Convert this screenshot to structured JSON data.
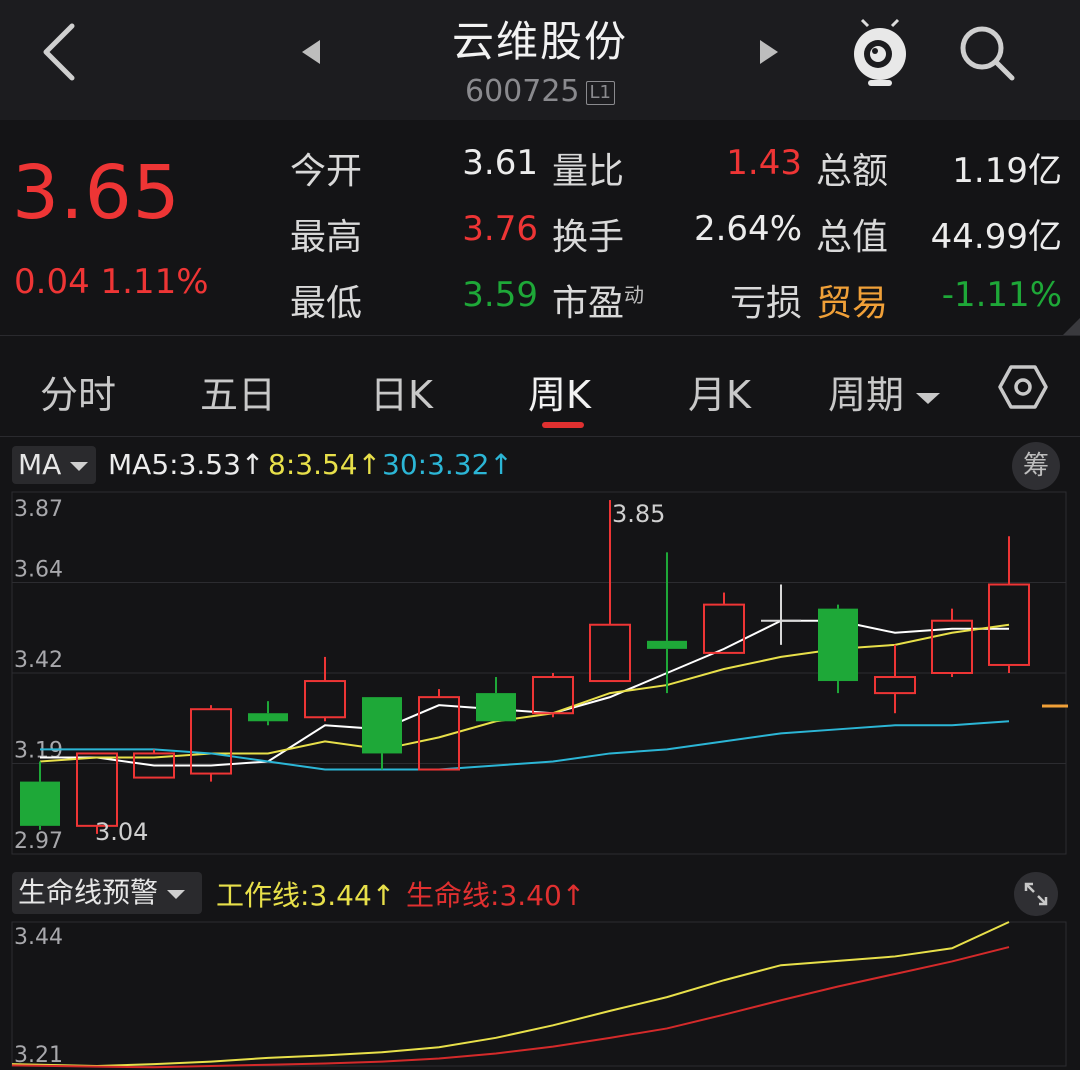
{
  "header": {
    "title": "云维股份",
    "code": "600725",
    "level_badge": "L1",
    "icons": [
      "back-icon",
      "prev-stock-icon",
      "next-stock-icon",
      "robot-assistant-icon",
      "search-icon"
    ]
  },
  "quote": {
    "price": "3.65",
    "change": "0.04",
    "change_pct": "1.11%",
    "rows": [
      {
        "l1": "今开",
        "v1": "3.61",
        "l2": "量比",
        "v2": "1.43",
        "l3": "总额",
        "v3": "1.19亿"
      },
      {
        "l1": "最高",
        "v1": "3.76",
        "l2": "换手",
        "v2": "2.64%",
        "l3": "总值",
        "v3": "44.99亿"
      },
      {
        "l1": "最低",
        "v1": "3.59",
        "l2": "市盈",
        "l2_sup": "动",
        "v2": "亏损",
        "l3": "贸易",
        "v3": "-1.11%"
      }
    ]
  },
  "tabs": [
    {
      "label": "分时"
    },
    {
      "label": "五日"
    },
    {
      "label": "日K"
    },
    {
      "label": "周K",
      "active": true
    },
    {
      "label": "月K"
    },
    {
      "label": "周期"
    }
  ],
  "ma_bar": {
    "selector": "MA",
    "ma5": "MA5:",
    "ma5_val": "3.53↑",
    "ma8": "8:",
    "ma8_val": "3.54↑",
    "ma30": "30:",
    "ma30_val": "3.32↑",
    "chip_button": "筹"
  },
  "indicator_bar": {
    "selector": "生命线预警",
    "work_label": "工作线:",
    "work_val": "3.44↑",
    "life_label": "生命线:",
    "life_val": "3.40↑"
  },
  "colors": {
    "up": "#ee3535",
    "down": "#1ea838",
    "ma5": "#ffffff",
    "ma8": "#e8e04a",
    "ma30": "#2cb6d6",
    "work": "#e8e04a",
    "life": "#d42a2a",
    "accent": "#f0a038"
  },
  "chart_data": [
    {
      "type": "candlestick",
      "y_ticks": [
        "3.87",
        "3.64",
        "3.42",
        "3.19",
        "2.97"
      ],
      "ylim": [
        2.97,
        3.87
      ],
      "annotations": {
        "max": "3.85",
        "min": "3.04"
      },
      "candles": [
        {
          "o": 3.15,
          "c": 3.04,
          "h": 3.2,
          "l": 3.03
        },
        {
          "o": 3.04,
          "c": 3.22,
          "h": 3.22,
          "l": 3.02
        },
        {
          "o": 3.16,
          "c": 3.22,
          "h": 3.23,
          "l": 3.16
        },
        {
          "o": 3.17,
          "c": 3.33,
          "h": 3.34,
          "l": 3.15
        },
        {
          "o": 3.32,
          "c": 3.3,
          "h": 3.35,
          "l": 3.29
        },
        {
          "o": 3.31,
          "c": 3.4,
          "h": 3.46,
          "l": 3.3
        },
        {
          "o": 3.36,
          "c": 3.22,
          "h": 3.36,
          "l": 3.18
        },
        {
          "o": 3.18,
          "c": 3.36,
          "h": 3.38,
          "l": 3.18
        },
        {
          "o": 3.37,
          "c": 3.3,
          "h": 3.41,
          "l": 3.3
        },
        {
          "o": 3.32,
          "c": 3.41,
          "h": 3.42,
          "l": 3.31
        },
        {
          "o": 3.4,
          "c": 3.54,
          "h": 3.85,
          "l": 3.4
        },
        {
          "o": 3.5,
          "c": 3.48,
          "h": 3.72,
          "l": 3.37
        },
        {
          "o": 3.47,
          "c": 3.59,
          "h": 3.62,
          "l": 3.47
        },
        {
          "o": 3.55,
          "c": 3.55,
          "h": 3.64,
          "l": 3.49
        },
        {
          "o": 3.58,
          "c": 3.4,
          "h": 3.59,
          "l": 3.37
        },
        {
          "o": 3.37,
          "c": 3.41,
          "h": 3.49,
          "l": 3.32
        },
        {
          "o": 3.42,
          "c": 3.55,
          "h": 3.58,
          "l": 3.41
        },
        {
          "o": 3.44,
          "c": 3.64,
          "h": 3.76,
          "l": 3.42
        }
      ],
      "series": [
        {
          "name": "MA5",
          "values": [
            3.21,
            3.21,
            3.19,
            3.19,
            3.2,
            3.29,
            3.28,
            3.34,
            3.33,
            3.32,
            3.36,
            3.42,
            3.48,
            3.55,
            3.55,
            3.52,
            3.53,
            3.53
          ]
        },
        {
          "name": "8",
          "values": [
            3.2,
            3.21,
            3.21,
            3.22,
            3.22,
            3.25,
            3.23,
            3.26,
            3.3,
            3.32,
            3.37,
            3.39,
            3.43,
            3.46,
            3.48,
            3.49,
            3.52,
            3.54
          ]
        },
        {
          "name": "30",
          "values": [
            3.23,
            3.23,
            3.23,
            3.22,
            3.2,
            3.18,
            3.18,
            3.18,
            3.19,
            3.2,
            3.22,
            3.23,
            3.25,
            3.27,
            3.28,
            3.29,
            3.29,
            3.3
          ]
        }
      ]
    },
    {
      "type": "line",
      "y_ticks": [
        "3.44",
        "3.21"
      ],
      "ylim": [
        3.21,
        3.44
      ],
      "series": [
        {
          "name": "工作线",
          "values": [
            3.213,
            3.21,
            3.213,
            3.217,
            3.223,
            3.227,
            3.232,
            3.24,
            3.255,
            3.275,
            3.298,
            3.32,
            3.347,
            3.371,
            3.378,
            3.385,
            3.398,
            3.44
          ]
        },
        {
          "name": "生命线",
          "values": [
            3.211,
            3.209,
            3.208,
            3.21,
            3.212,
            3.214,
            3.217,
            3.222,
            3.23,
            3.241,
            3.255,
            3.27,
            3.292,
            3.315,
            3.337,
            3.357,
            3.377,
            3.4
          ]
        }
      ]
    }
  ]
}
